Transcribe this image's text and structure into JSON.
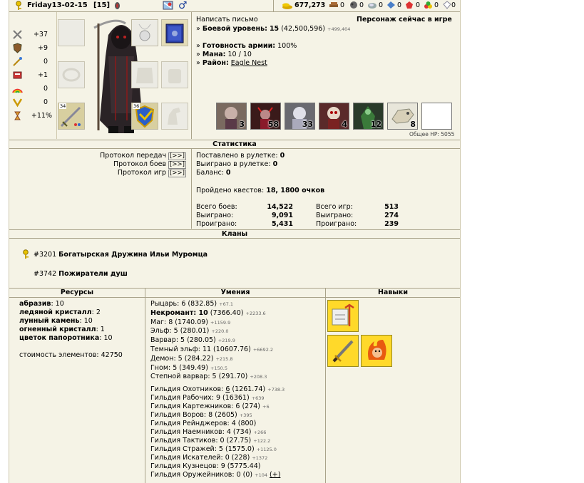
{
  "header": {
    "name": "Friday13-02-15",
    "level": "[15]",
    "resources": [
      "677,273",
      "0",
      "0",
      "0",
      "0",
      "0",
      "0",
      "0"
    ]
  },
  "stats_left": [
    {
      "icon": "attack-icon",
      "value": "+37"
    },
    {
      "icon": "defense-icon",
      "value": "+9"
    },
    {
      "icon": "spellpower-icon",
      "value": "0"
    },
    {
      "icon": "knowledge-icon",
      "value": "+1"
    },
    {
      "icon": "luck-icon",
      "value": "0"
    },
    {
      "icon": "morale-icon",
      "value": "0"
    },
    {
      "icon": "initiative-icon",
      "value": "+11%"
    }
  ],
  "equip_numbers": {
    "left": "34",
    "right": "36"
  },
  "info": {
    "write_letter": "Написать письмо",
    "online": "Персонаж сейчас в игре",
    "combat_label": "Боевой уровень:",
    "combat_value": "15",
    "combat_exp": "(42,500,596)",
    "combat_delta": "+499,404",
    "army_label": "Готовность армии:",
    "army_value": "100%",
    "mana_label": "Мана:",
    "mana_value": "10 / 10",
    "district_label": "Район:",
    "district_value": "Eagle Nest"
  },
  "army": [
    "3",
    "58",
    "33",
    "4",
    "12",
    "8",
    ""
  ],
  "total_hp": "Общее HP:  5055",
  "section_titles": {
    "stats": "Статистика",
    "clans": "Кланы",
    "res": "Ресурсы",
    "skills": "Умения",
    "talents": "Навыки"
  },
  "protocols": [
    {
      "label": "Протокол передач",
      "link": "[>>]"
    },
    {
      "label": "Протокол боев",
      "link": "[>>]"
    },
    {
      "label": "Протокол игр",
      "link": "[>>]"
    }
  ],
  "roulette": {
    "bet_label": "Поставлено в рулетке:",
    "bet": "0",
    "won_label": "Выиграно в рулетке:",
    "won": "0",
    "balance_label": "Баланс:",
    "balance": "0",
    "quests_label": "Пройдено квестов:",
    "quests": "18, 1800 очков"
  },
  "battles": [
    {
      "label": "Всего боев:",
      "value": "14,522"
    },
    {
      "label": "Выиграно:",
      "value": "9,091"
    },
    {
      "label": "Проиграно:",
      "value": "5,431"
    }
  ],
  "games": [
    {
      "label": "Всего игр:",
      "value": "513"
    },
    {
      "label": "Выиграно:",
      "value": "274"
    },
    {
      "label": "Проиграно:",
      "value": "239"
    }
  ],
  "clans": [
    {
      "id": "#3201",
      "name": "Богатырская Дружина Ильи Муромца"
    },
    {
      "id": "#3742",
      "name": "Пожиратели душ"
    }
  ],
  "resources": [
    {
      "name": "абразив",
      "value": ": 10"
    },
    {
      "name": "ледяной кристалл",
      "value": ": 2"
    },
    {
      "name": "лунный камень",
      "value": ": 10"
    },
    {
      "name": "огненный кристалл",
      "value": ": 1"
    },
    {
      "name": "цветок папоротника",
      "value": ": 10"
    }
  ],
  "elements_cost": "стоимость элементов: 42750",
  "factions": [
    {
      "name": "Рыцарь: 6 (832.85)",
      "delta": "+67.1",
      "bold": false
    },
    {
      "name": "Некромант: 10",
      "extra": " (7366.40)",
      "delta": "+2233.6",
      "bold": true
    },
    {
      "name": "Маг: 8 (1740.09)",
      "delta": "+1159.9",
      "bold": false
    },
    {
      "name": "Эльф: 5 (280.01)",
      "delta": "+220.0",
      "bold": false
    },
    {
      "name": "Варвар: 5 (280.05)",
      "delta": "+219.9",
      "bold": false
    },
    {
      "name": "Темный эльф: 11 (10607.76)",
      "delta": "+6692.2",
      "bold": false
    },
    {
      "name": "Демон: 5 (284.22)",
      "delta": "+215.8",
      "bold": false
    },
    {
      "name": "Гном: 5 (349.49)",
      "delta": "+150.5",
      "bold": false
    },
    {
      "name": "Степной варвар: 5 (291.70)",
      "delta": "+208.3",
      "bold": false
    }
  ],
  "guilds": [
    {
      "name": "Гильдия Охотников: ",
      "u": "6",
      "rest": " (1261.74)",
      "delta": "+738.3"
    },
    {
      "name": "Гильдия Рабочих: 9 (16361)",
      "u": "",
      "rest": "",
      "delta": "+639"
    },
    {
      "name": "Гильдия Картежников: 6 (274)",
      "u": "",
      "rest": "",
      "delta": "+6"
    },
    {
      "name": "Гильдия Воров: 8 (2605)",
      "u": "",
      "rest": "",
      "delta": "+395"
    },
    {
      "name": "Гильдия Рейнджеров: 4 (800)",
      "u": "",
      "rest": "",
      "delta": ""
    },
    {
      "name": "Гильдия Наемников: 4 (734)",
      "u": "",
      "rest": "",
      "delta": "+266"
    },
    {
      "name": "Гильдия Тактиков: 0 (27.75)",
      "u": "",
      "rest": "",
      "delta": "+122.2"
    },
    {
      "name": "Гильдия Стражей: 5 (1575.0)",
      "u": "",
      "rest": "",
      "delta": "+1125.0"
    },
    {
      "name": "Гильдия Искателей: 0 (228)",
      "u": "",
      "rest": "",
      "delta": "+1372"
    },
    {
      "name": "Гильдия Кузнецов: 9 (5775.44)",
      "u": "",
      "rest": "",
      "delta": ""
    },
    {
      "name": "Гильдия Оружейников: 0 (0)",
      "u": "",
      "rest": "",
      "delta": "+104",
      "plus": "(+)"
    }
  ],
  "colors": {
    "bg": "#f5f3e6",
    "border": "#a9a38a",
    "gold": "#ffd92a"
  }
}
